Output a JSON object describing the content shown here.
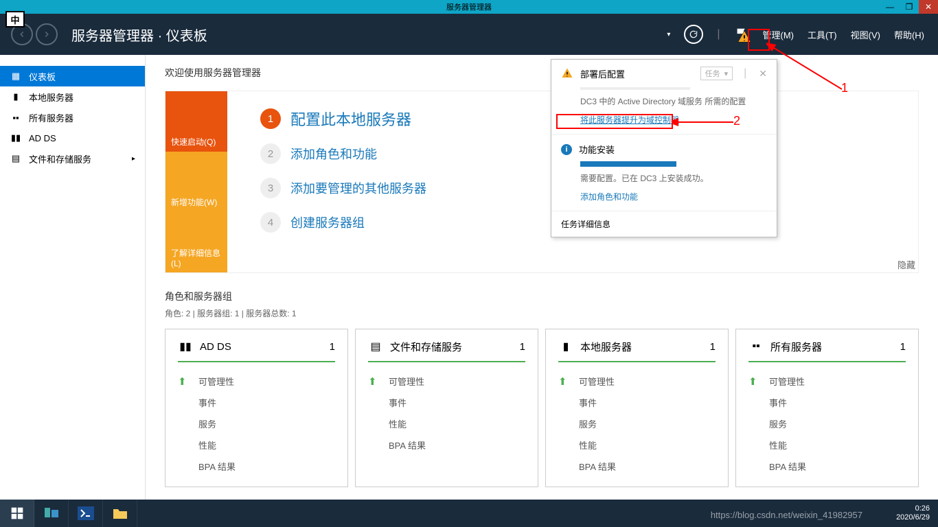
{
  "window": {
    "title": "服务器管理器",
    "ime": "中"
  },
  "header": {
    "breadcrumb_app": "服务器管理器",
    "breadcrumb_page": "仪表板",
    "menus": {
      "manage": "管理(M)",
      "tools": "工具(T)",
      "view": "视图(V)",
      "help": "帮助(H)"
    }
  },
  "sidebar": {
    "items": [
      {
        "label": "仪表板"
      },
      {
        "label": "本地服务器"
      },
      {
        "label": "所有服务器"
      },
      {
        "label": "AD DS"
      },
      {
        "label": "文件和存储服务"
      }
    ]
  },
  "welcome": {
    "title": "欢迎使用服务器管理器",
    "tiles": {
      "quick": "快速启动(Q)",
      "new": "新增功能(W)",
      "learn": "了解详细信息(L)"
    },
    "steps": {
      "s1": "配置此本地服务器",
      "s2": "添加角色和功能",
      "s3": "添加要管理的其他服务器",
      "s4": "创建服务器组"
    },
    "hide": "隐藏"
  },
  "roles": {
    "title": "角色和服务器组",
    "subtitle": "角色: 2 | 服务器组: 1 | 服务器总数: 1",
    "tiles": [
      {
        "title": "AD DS",
        "count": "1",
        "rows": [
          "可管理性",
          "事件",
          "服务",
          "性能",
          "BPA 结果"
        ]
      },
      {
        "title": "文件和存储服务",
        "count": "1",
        "rows": [
          "可管理性",
          "事件",
          "性能",
          "BPA 结果"
        ]
      },
      {
        "title": "本地服务器",
        "count": "1",
        "rows": [
          "可管理性",
          "事件",
          "服务",
          "性能",
          "BPA 结果"
        ]
      },
      {
        "title": "所有服务器",
        "count": "1",
        "rows": [
          "可管理性",
          "事件",
          "服务",
          "性能",
          "BPA 结果"
        ]
      }
    ]
  },
  "notification": {
    "section1": {
      "title": "部署后配置",
      "dropdown": "任务",
      "desc": "DC3 中的 Active Directory 域服务 所需的配置",
      "link": "将此服务器提升为域控制器"
    },
    "section2": {
      "title": "功能安装",
      "desc": "需要配置。已在 DC3 上安装成功。",
      "link": "添加角色和功能"
    },
    "footer": "任务详细信息"
  },
  "annotations": {
    "a1": "1",
    "a2": "2"
  },
  "taskbar": {
    "time": "0:26",
    "date": "2020/6/29",
    "watermark": "https://blog.csdn.net/weixin_41982957"
  }
}
